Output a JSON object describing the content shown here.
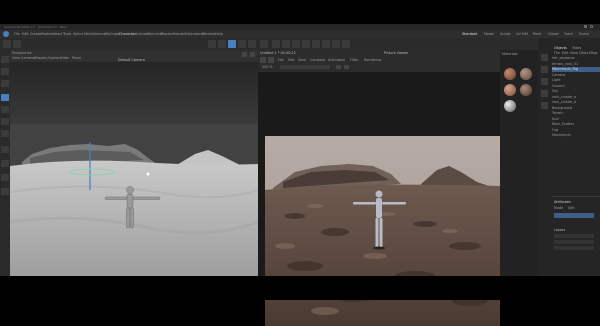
{
  "window": {
    "title": "Cinema 4D 2025.1.1 - [Untitled 1*] - Main"
  },
  "menu": {
    "items": [
      "File",
      "Edit",
      "Create",
      "Modes",
      "Select",
      "Tools",
      "Spline",
      "Mesh",
      "Volume",
      "MoGraph",
      "Character",
      "Animate",
      "Simulate",
      "Tracker",
      "Render",
      "Extensions",
      "Window",
      "Help"
    ],
    "layouts": [
      "Standard",
      "Model",
      "Sculpt",
      "UV Edit",
      "Paint",
      "Groom",
      "Track",
      "Script",
      "Nodes"
    ],
    "active_layout": "Standard"
  },
  "viewport": {
    "label": "Perspective",
    "camera_label": "Default Camera",
    "tabs": [
      "View",
      "Cameras",
      "Display",
      "Options",
      "Filter",
      "Panel"
    ]
  },
  "picture_viewer": {
    "title": "Picture Viewer",
    "file_label": "Untitled 1 * 00:00:22",
    "menu": [
      "File",
      "Edit",
      "View",
      "Compare",
      "Animation",
      "Filter",
      "Rendering"
    ],
    "zoom": "100 %"
  },
  "materials": {
    "label": "Materials"
  },
  "objects": {
    "tabs": [
      "Objects",
      "Takes"
    ],
    "menu": [
      "File",
      "Edit",
      "View",
      "Object",
      "Tags"
    ],
    "items": [
      "hdr_skydome",
      "terrain_rock_01",
      "Mannequin_Rig",
      "Camera",
      "Light",
      "Ground",
      "Sky",
      "rock_cluster_a",
      "rock_cluster_b",
      "Background",
      "Terrain",
      "Null",
      "Rock_Scatter",
      "Fog",
      "Mannequin"
    ]
  },
  "attributes": {
    "title": "Attributes",
    "section": "Layers",
    "mode": "Mode",
    "edit": "Edit"
  },
  "colors": {
    "accent": "#4a7fc0",
    "selected": "#3d5e86",
    "panel_bg": "#252525"
  }
}
